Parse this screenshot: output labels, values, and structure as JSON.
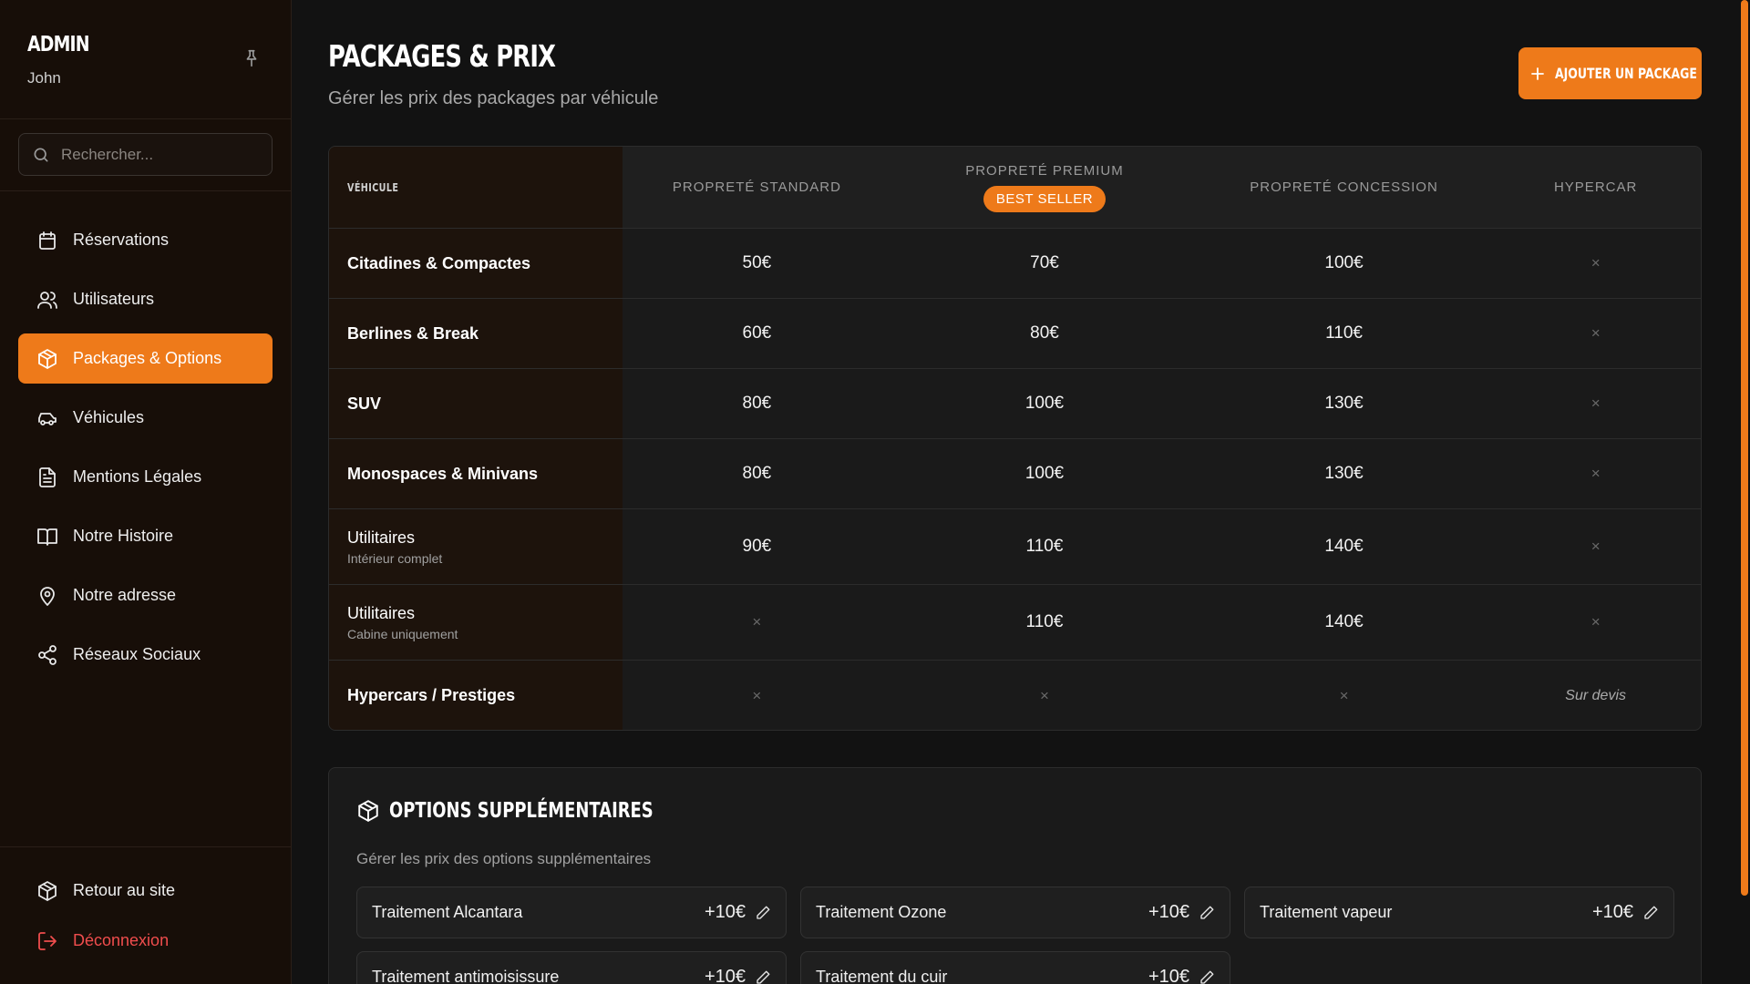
{
  "sidebar": {
    "title": "ADMIN",
    "user": "John",
    "search_placeholder": "Rechercher...",
    "items": [
      {
        "label": "Réservations",
        "icon": "calendar-icon",
        "active": false
      },
      {
        "label": "Utilisateurs",
        "icon": "users-icon",
        "active": false
      },
      {
        "label": "Packages & Options",
        "icon": "package-icon",
        "active": true
      },
      {
        "label": "Véhicules",
        "icon": "car-icon",
        "active": false
      },
      {
        "label": "Mentions Légales",
        "icon": "document-icon",
        "active": false
      },
      {
        "label": "Notre Histoire",
        "icon": "book-icon",
        "active": false
      },
      {
        "label": "Notre adresse",
        "icon": "map-pin-icon",
        "active": false
      },
      {
        "label": "Réseaux Sociaux",
        "icon": "share-icon",
        "active": false
      }
    ],
    "bottom": {
      "back_label": "Retour au site",
      "logout_label": "Déconnexion"
    }
  },
  "header": {
    "title": "PACKAGES & PRIX",
    "subtitle": "Gérer les prix des packages par véhicule",
    "add_button": "AJOUTER UN PACKAGE"
  },
  "table": {
    "vehicle_header": "VÉHICULE",
    "columns": [
      {
        "label": "PROPRETÉ STANDARD",
        "badge": ""
      },
      {
        "label": "PROPRETÉ PREMIUM",
        "badge": "BEST SELLER"
      },
      {
        "label": "PROPRETÉ CONCESSION",
        "badge": ""
      },
      {
        "label": "HYPERCAR",
        "badge": ""
      }
    ],
    "rows": [
      {
        "name": "Citadines & Compactes",
        "sub": "",
        "prices": [
          "50€",
          "70€",
          "100€",
          "×"
        ]
      },
      {
        "name": "Berlines & Break",
        "sub": "",
        "prices": [
          "60€",
          "80€",
          "110€",
          "×"
        ]
      },
      {
        "name": "SUV",
        "sub": "",
        "prices": [
          "80€",
          "100€",
          "130€",
          "×"
        ]
      },
      {
        "name": "Monospaces & Minivans",
        "sub": "",
        "prices": [
          "80€",
          "100€",
          "130€",
          "×"
        ]
      },
      {
        "name": "Utilitaires",
        "sub": "Intérieur complet",
        "prices": [
          "90€",
          "110€",
          "140€",
          "×"
        ]
      },
      {
        "name": "Utilitaires",
        "sub": "Cabine uniquement",
        "prices": [
          "×",
          "110€",
          "140€",
          "×"
        ]
      },
      {
        "name": "Hypercars / Prestiges",
        "sub": "",
        "prices": [
          "×",
          "×",
          "×",
          "Sur devis"
        ]
      }
    ]
  },
  "options": {
    "title": "OPTIONS SUPPLÉMENTAIRES",
    "subtitle": "Gérer les prix des options supplémentaires",
    "items": [
      {
        "name": "Traitement Alcantara",
        "price": "+10€"
      },
      {
        "name": "Traitement Ozone",
        "price": "+10€"
      },
      {
        "name": "Traitement vapeur",
        "price": "+10€"
      },
      {
        "name": "Traitement antimoisissure",
        "price": "+10€"
      },
      {
        "name": "Traitement du cuir",
        "price": "+10€"
      }
    ]
  },
  "colors": {
    "accent": "#ee7a1a",
    "danger": "#f04d4d",
    "bg": "#121212",
    "sidebar": "#170e08"
  }
}
